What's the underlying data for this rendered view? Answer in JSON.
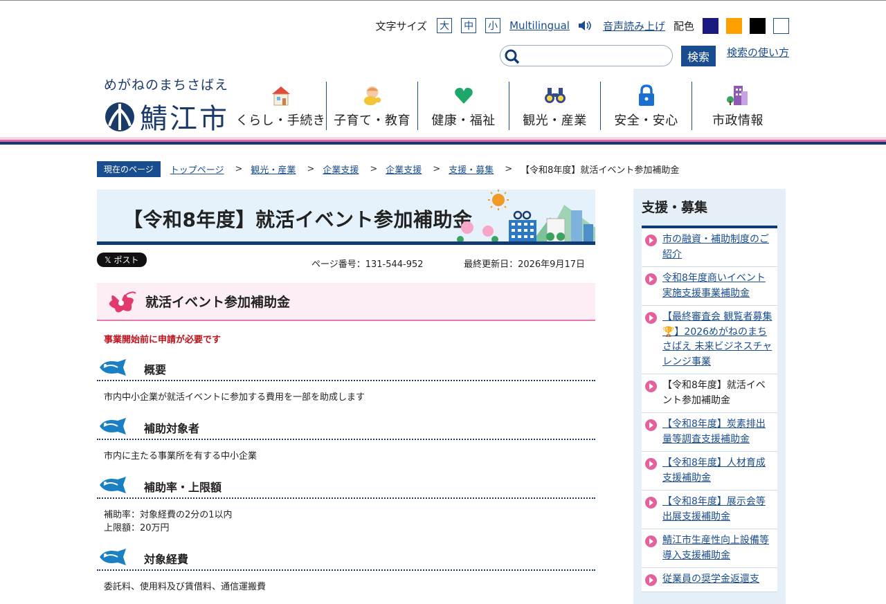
{
  "util": {
    "font_size_label": "文字サイズ",
    "size_large": "大",
    "size_medium": "中",
    "size_small": "小",
    "multilingual": "Multilingual",
    "read_aloud": "音声読み上げ",
    "color_label": "配色",
    "color_options": [
      "#1a1a80",
      "#ffa000",
      "#000000",
      "#ffffff"
    ]
  },
  "search": {
    "placeholder": "",
    "button": "検索",
    "howto": "検索の使い方"
  },
  "logo": {
    "tagline": "めがねのまちさばえ",
    "name": "鯖江市"
  },
  "nav": [
    {
      "label": "くらし・手続き",
      "icon": "house-icon"
    },
    {
      "label": "子育て・教育",
      "icon": "baby-icon"
    },
    {
      "label": "健康・福祉",
      "icon": "heart-icon"
    },
    {
      "label": "観光・産業",
      "icon": "binoculars-icon"
    },
    {
      "label": "安全・安心",
      "icon": "lock-icon"
    },
    {
      "label": "市政情報",
      "icon": "building-icon"
    }
  ],
  "breadcrumb": {
    "here": "現在のページ",
    "items": [
      "トップページ",
      "観光・産業",
      "企業支援",
      "企業支援",
      "支援・募集"
    ],
    "current": "【令和8年度】就活イベント参加補助金"
  },
  "page": {
    "title": "【令和8年度】就活イベント参加補助金",
    "post": "ポスト",
    "page_number": "ページ番号：131-544-952",
    "updated": "最終更新日：2026年9月17日",
    "section_title": "就活イベント参加補助金",
    "notice": "事業開始前に申請が必要です",
    "sections": [
      {
        "heading": "概要",
        "lines": [
          "市内中小企業が就活イベントに参加する費用を一部を助成します"
        ]
      },
      {
        "heading": "補助対象者",
        "lines": [
          "市内に主たる事業所を有する中小企業"
        ]
      },
      {
        "heading": "補助率・上限額",
        "lines": [
          "補助率：対象経費の2分の1以内",
          "上限額：20万円"
        ]
      },
      {
        "heading": "対象経費",
        "lines": [
          "委託料、使用料及び賃借料、通信運搬費"
        ]
      }
    ]
  },
  "side": {
    "title": "支援・募集",
    "items": [
      "市の融資・補助制度のご紹介",
      "令和8年度商いイベント実施支援事業補助金",
      "【最終審査会 観覧者募集🏆】2026めがねのまちさばえ 未来ビジネスチャレンジ事業",
      "【令和8年度】就活イベント参加補助金",
      "【令和8年度】炭素排出量等調査支援補助金",
      "【令和8年度】人材育成支援補助金",
      "【令和8年度】展示会等出展支援補助金",
      "鯖江市生産性向上設備等導入支援補助金",
      "従業員の奨学金返還支"
    ]
  }
}
